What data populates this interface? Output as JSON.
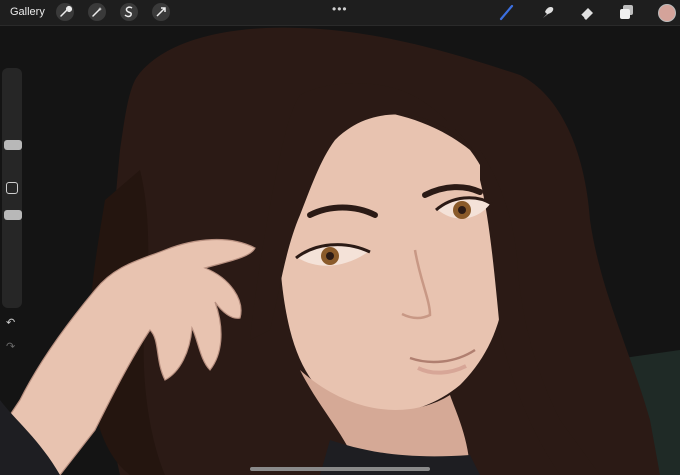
{
  "toolbar": {
    "gallery_label": "Gallery",
    "left_icons": [
      "wrench-icon",
      "magic-wand-icon",
      "selection-s-icon",
      "transform-arrow-icon"
    ],
    "more_label": "•••",
    "right_icons": [
      "brush-icon",
      "smudge-icon",
      "eraser-icon",
      "layers-icon"
    ],
    "current_color": "#d4a39a",
    "active_tool_color": "#3b6fe0"
  },
  "sidebar": {
    "brush_size_knob": "slider-knob",
    "opacity_knob": "slider-knob",
    "undo_label": "↶",
    "redo_label": "↷"
  },
  "colors": {
    "background": "#141414",
    "hair": "#2b1a15",
    "skin": "#e8c3b0",
    "skin_shadow": "#d5a996",
    "iris": "#8a5a2a",
    "lips": "#d7a697"
  }
}
